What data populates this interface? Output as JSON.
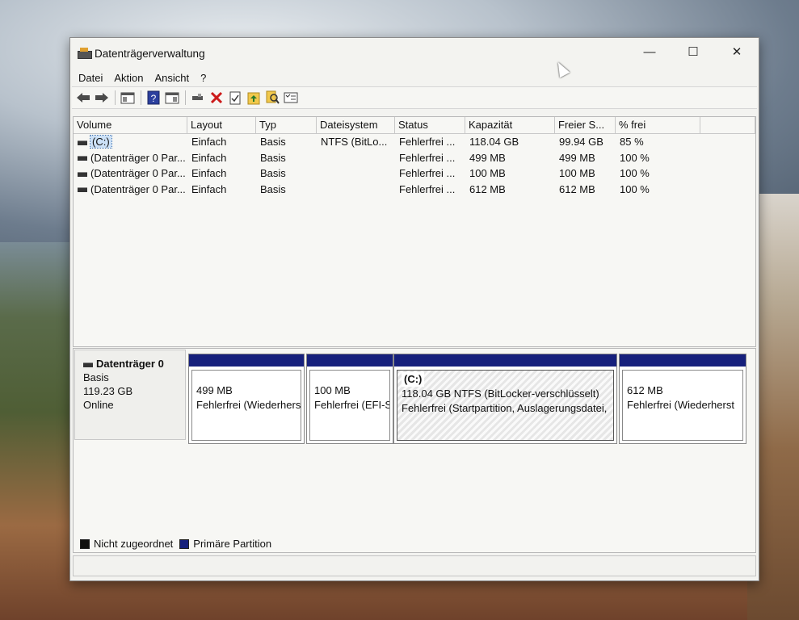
{
  "window": {
    "title": "Datenträgerverwaltung",
    "minimize": "—",
    "maximize": "☐",
    "close": "✕"
  },
  "menu": [
    "Datei",
    "Aktion",
    "Ansicht",
    "?"
  ],
  "toolbar_icons": [
    "back-arrow-icon",
    "forward-arrow-icon",
    "console-tree-icon",
    "help-icon",
    "action-pane-icon",
    "connect-disk-icon",
    "delete-icon",
    "properties-icon",
    "folder-up-icon",
    "search-icon",
    "list-view-icon"
  ],
  "columns": [
    "Volume",
    "Layout",
    "Typ",
    "Dateisystem",
    "Status",
    "Kapazität",
    "Freier S...",
    "% frei"
  ],
  "volumes": [
    {
      "name": "(C:)",
      "layout": "Einfach",
      "type": "Basis",
      "fs": "NTFS (BitLo...",
      "status": "Fehlerfrei ...",
      "capacity": "118.04 GB",
      "free": "99.94 GB",
      "pct": "85 %"
    },
    {
      "name": "(Datenträger 0 Par...",
      "layout": "Einfach",
      "type": "Basis",
      "fs": "",
      "status": "Fehlerfrei ...",
      "capacity": "499 MB",
      "free": "499 MB",
      "pct": "100 %"
    },
    {
      "name": "(Datenträger 0 Par...",
      "layout": "Einfach",
      "type": "Basis",
      "fs": "",
      "status": "Fehlerfrei ...",
      "capacity": "100 MB",
      "free": "100 MB",
      "pct": "100 %"
    },
    {
      "name": "(Datenträger 0 Par...",
      "layout": "Einfach",
      "type": "Basis",
      "fs": "",
      "status": "Fehlerfrei ...",
      "capacity": "612 MB",
      "free": "612 MB",
      "pct": "100 %"
    }
  ],
  "disk": {
    "name": "Datenträger 0",
    "type": "Basis",
    "size": "119.23 GB",
    "status": "Online"
  },
  "partitions": [
    {
      "name": "",
      "line1": "499 MB",
      "line2": "Fehlerfrei (Wiederhers"
    },
    {
      "name": "",
      "line1": "100 MB",
      "line2": "Fehlerfrei (EFI-S"
    },
    {
      "name": "(C:)",
      "line1": "118.04 GB NTFS (BitLocker-verschlüsselt)",
      "line2": "Fehlerfrei (Startpartition, Auslagerungsdatei,"
    },
    {
      "name": "",
      "line1": "612 MB",
      "line2": "Fehlerfrei (Wiederherst"
    }
  ],
  "legend": [
    {
      "label": "Nicht zugeordnet",
      "color": "#111111"
    },
    {
      "label": "Primäre Partition",
      "color": "#16207c"
    }
  ]
}
